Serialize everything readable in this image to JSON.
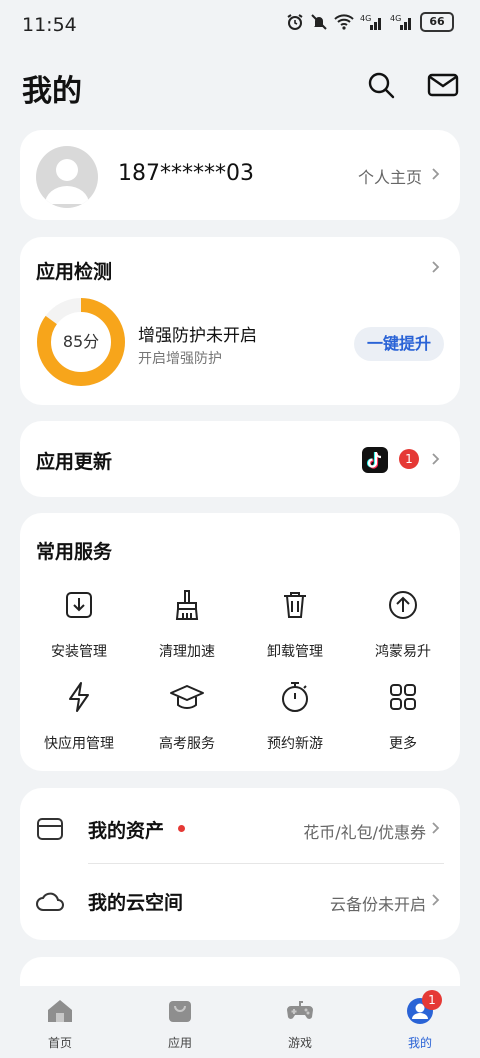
{
  "status_bar": {
    "time": "11:54",
    "battery": "66"
  },
  "header": {
    "title": "我的"
  },
  "profile": {
    "phone": "187******03",
    "homepage_label": "个人主页"
  },
  "app_check": {
    "title": "应用检测",
    "score": "85分",
    "score_value": 85,
    "protection_status": "增强防护未开启",
    "protection_hint": "开启增强防护",
    "boost_button": "一键提升"
  },
  "app_update": {
    "title": "应用更新",
    "badge": "1"
  },
  "services": {
    "title": "常用服务",
    "items": [
      {
        "label": "安装管理",
        "icon": "install-icon"
      },
      {
        "label": "清理加速",
        "icon": "broom-icon"
      },
      {
        "label": "卸载管理",
        "icon": "trash-icon"
      },
      {
        "label": "鸿蒙易升",
        "icon": "upgrade-icon"
      },
      {
        "label": "快应用管理",
        "icon": "lightning-icon"
      },
      {
        "label": "高考服务",
        "icon": "graduation-cap-icon"
      },
      {
        "label": "预约新游",
        "icon": "stopwatch-icon"
      },
      {
        "label": "更多",
        "icon": "grid-icon"
      }
    ]
  },
  "assets": {
    "title": "我的资产",
    "detail": "花币/礼包/优惠券",
    "cloud_title": "我的云空间",
    "cloud_detail": "云备份未开启"
  },
  "tabbar": {
    "items": [
      {
        "label": "首页"
      },
      {
        "label": "应用"
      },
      {
        "label": "游戏"
      },
      {
        "label": "我的"
      }
    ],
    "me_badge": "1",
    "active_color": "#2a63d6"
  }
}
